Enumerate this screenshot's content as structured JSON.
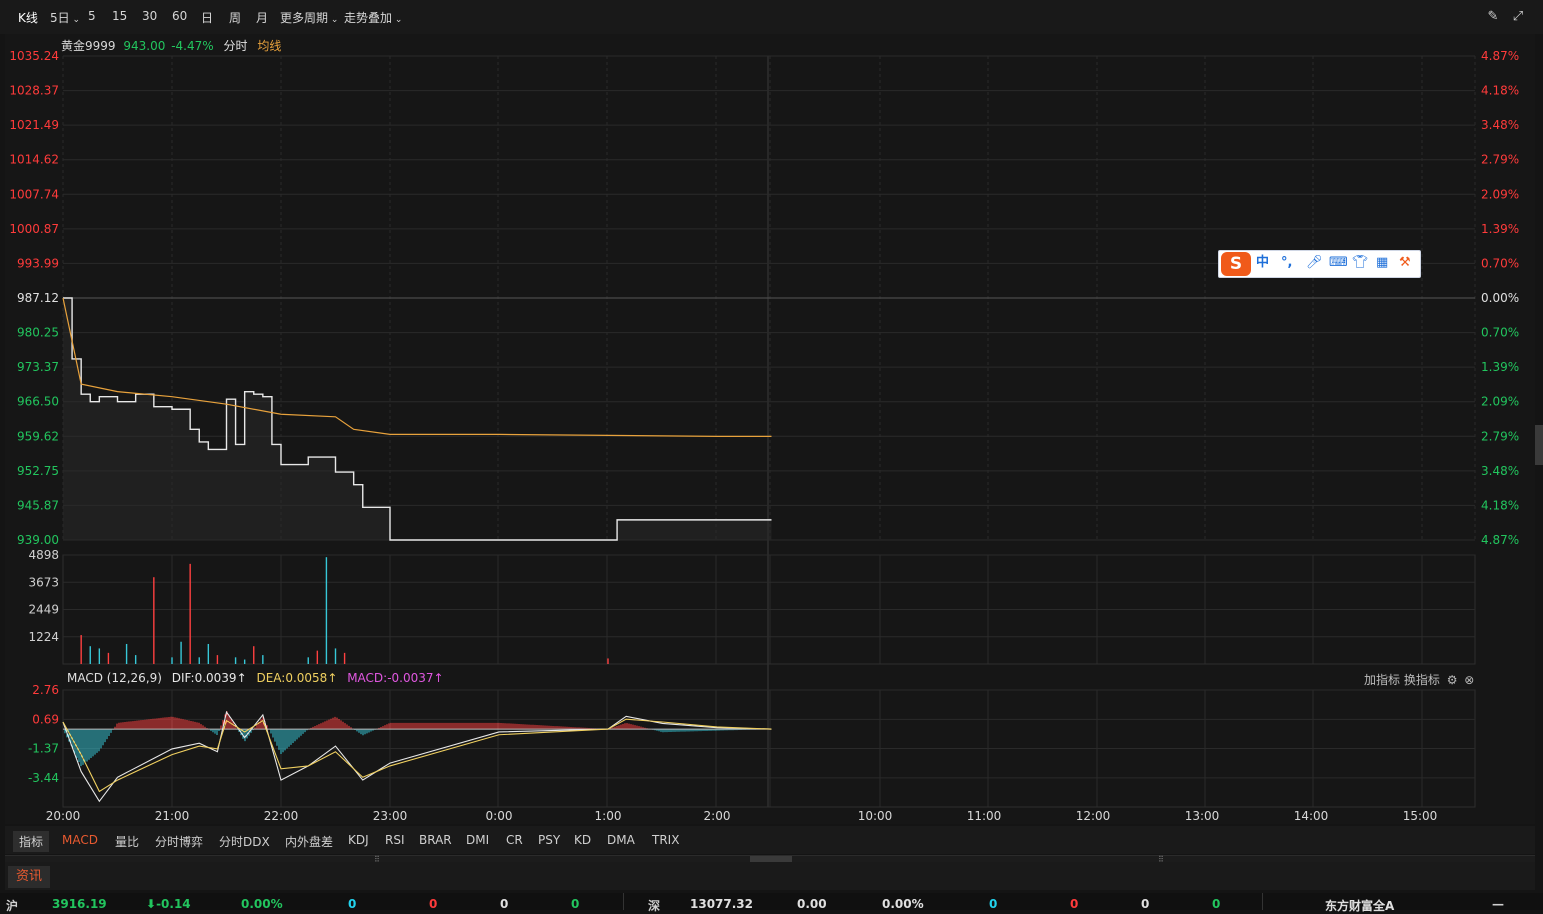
{
  "toolbar": {
    "periods": [
      "K线",
      "5日",
      "5",
      "15",
      "30",
      "60",
      "日",
      "周",
      "月",
      "更多周期",
      "走势叠加"
    ],
    "pen_icon": "pen-icon",
    "expand_icon": "expand-icon"
  },
  "chart_header": {
    "symbol": "黄金9999",
    "price": "943.00",
    "change_pct": "-4.47%",
    "mode": "分时",
    "avg_label": "均线"
  },
  "colors": {
    "up": "#ff3b3b",
    "down": "#22c55e",
    "price_line": "#e8e8e8",
    "avg_line": "#e8a23c",
    "vol_up": "#ff4040",
    "vol_down": "#37c8d8",
    "dea": "#f0d060",
    "macd_label": "#e057e0",
    "grid": "#2a2a2a"
  },
  "price_axis": {
    "left_up": [
      "1035.24",
      "1028.37",
      "1021.49",
      "1014.62",
      "1007.74",
      "1000.87",
      "993.99"
    ],
    "base": "987.12",
    "left_down": [
      "980.25",
      "973.37",
      "966.50",
      "959.62",
      "952.75",
      "945.87",
      "939.00"
    ],
    "right_up": [
      "4.87%",
      "4.18%",
      "3.48%",
      "2.79%",
      "2.09%",
      "1.39%",
      "0.70%"
    ],
    "right_base": "0.00%",
    "right_down": [
      "0.70%",
      "1.39%",
      "2.09%",
      "2.79%",
      "3.48%",
      "4.18%",
      "4.87%"
    ]
  },
  "volume_axis": [
    "4898",
    "3673",
    "2449",
    "1224"
  ],
  "macd": {
    "title": "MACD (12,26,9)",
    "dif": "DIF:0.0039",
    "dea": "DEA:0.0058",
    "macd": "MACD:-0.0037",
    "axis": [
      "2.76",
      "0.69",
      "-1.37",
      "-3.44"
    ],
    "add_indicator": "加指标",
    "switch_indicator": "换指标"
  },
  "time_axis": [
    "20:00",
    "21:00",
    "22:00",
    "23:00",
    "0:00",
    "1:00",
    "2:00",
    "10:00",
    "11:00",
    "12:00",
    "13:00",
    "14:00",
    "15:00"
  ],
  "indicator_tabs": [
    "指标",
    "MACD",
    "量比",
    "分时博弈",
    "分时DDX",
    "内外盘差",
    "KDJ",
    "RSI",
    "BRAR",
    "DMI",
    "CR",
    "PSY",
    "KD",
    "DMA",
    "TRIX"
  ],
  "news_tab": "资讯",
  "ticker": {
    "sh_label": "沪",
    "sh_index": "3916.19",
    "sh_change": "-0.14",
    "sh_pct": "0.00%",
    "sh_v1": "0",
    "sh_v2": "0",
    "sh_v3": "0",
    "sh_v4": "0",
    "sz_label": "深",
    "sz_index": "13077.32",
    "sz_change": "0.00",
    "sz_pct": "0.00%",
    "sz_v1": "0",
    "sz_v2": "0",
    "sz_v3": "0",
    "sz_v4": "0",
    "right_label": "东方财富全A"
  },
  "ime_toolbar": {
    "logo": "S",
    "items": [
      "中",
      "°,",
      "mic-icon",
      "keyboard-icon",
      "shirt-icon",
      "grid-icon",
      "tool-icon"
    ]
  },
  "chart_data": [
    {
      "type": "line",
      "title": "黄金9999",
      "series": [
        {
          "name": "分时",
          "x": [
            "20:00",
            "20:05",
            "20:10",
            "20:15",
            "20:20",
            "20:30",
            "20:40",
            "20:50",
            "21:00",
            "21:10",
            "21:15",
            "21:20",
            "21:30",
            "21:35",
            "21:40",
            "21:45",
            "21:50",
            "21:55",
            "22:00",
            "22:15",
            "22:25",
            "22:30",
            "22:40",
            "22:45",
            "22:50",
            "23:00",
            "23:30",
            "0:00",
            "0:30",
            "1:00",
            "1:05",
            "1:30",
            "2:00",
            "2:30"
          ],
          "values": [
            987.12,
            975.0,
            968.0,
            966.5,
            967.5,
            966.5,
            968.0,
            965.5,
            965.0,
            961.0,
            958.5,
            957.0,
            967.0,
            958.0,
            968.5,
            968.0,
            967.5,
            958.0,
            954.0,
            955.5,
            955.5,
            952.5,
            950.0,
            945.5,
            945.5,
            939.0,
            939.0,
            939.0,
            939.0,
            939.0,
            943.0,
            943.0,
            943.0,
            943.0
          ]
        },
        {
          "name": "均线",
          "x": [
            "20:00",
            "20:10",
            "20:30",
            "21:00",
            "21:30",
            "22:00",
            "22:30",
            "22:40",
            "23:00",
            "0:00",
            "1:00",
            "2:00",
            "2:30"
          ],
          "values": [
            987.12,
            970.0,
            968.5,
            967.5,
            966.0,
            964.0,
            963.5,
            961.0,
            960.0,
            960.0,
            959.8,
            959.6,
            959.6
          ]
        }
      ],
      "ylim": [
        939.0,
        1035.24
      ]
    },
    {
      "type": "bar",
      "title": "volume",
      "x": [
        "20:10",
        "20:15",
        "20:20",
        "20:25",
        "20:35",
        "20:40",
        "20:50",
        "21:00",
        "21:05",
        "21:10",
        "21:15",
        "21:20",
        "21:25",
        "21:35",
        "21:40",
        "21:45",
        "21:50",
        "22:15",
        "22:20",
        "22:25",
        "22:30",
        "22:35",
        "1:00"
      ],
      "values": [
        1300,
        800,
        700,
        500,
        900,
        400,
        3900,
        300,
        1000,
        4500,
        300,
        900,
        400,
        300,
        200,
        800,
        400,
        300,
        600,
        4800,
        700,
        500,
        250
      ],
      "ylim": [
        0,
        4898
      ]
    },
    {
      "type": "line",
      "title": "MACD (12,26,9)",
      "series": [
        {
          "name": "DIF",
          "x": [
            "20:00",
            "20:10",
            "20:20",
            "20:30",
            "21:00",
            "21:15",
            "21:25",
            "21:30",
            "21:40",
            "21:50",
            "22:00",
            "22:15",
            "22:30",
            "22:45",
            "23:00",
            "0:00",
            "1:00",
            "1:10",
            "1:30",
            "2:00",
            "2:30"
          ],
          "values": [
            0.5,
            -3.0,
            -5.1,
            -3.4,
            -1.4,
            -1.0,
            -1.6,
            1.2,
            -0.6,
            1.0,
            -3.6,
            -2.6,
            -1.2,
            -3.6,
            -2.4,
            -0.2,
            0.0,
            0.9,
            0.4,
            0.1,
            0.0
          ]
        },
        {
          "name": "DEA",
          "x": [
            "20:00",
            "20:10",
            "20:20",
            "20:30",
            "21:00",
            "21:15",
            "21:25",
            "21:30",
            "21:40",
            "21:50",
            "22:00",
            "22:15",
            "22:30",
            "22:45",
            "23:00",
            "0:00",
            "1:00",
            "1:10",
            "1:30",
            "2:00",
            "2:30"
          ],
          "values": [
            0.5,
            -1.8,
            -4.4,
            -3.6,
            -1.8,
            -1.2,
            -1.4,
            0.6,
            -0.2,
            0.6,
            -2.8,
            -2.6,
            -1.6,
            -3.4,
            -2.6,
            -0.4,
            0.0,
            0.7,
            0.5,
            0.15,
            0.0
          ]
        }
      ],
      "ylim": [
        -5.5,
        2.76
      ]
    }
  ]
}
